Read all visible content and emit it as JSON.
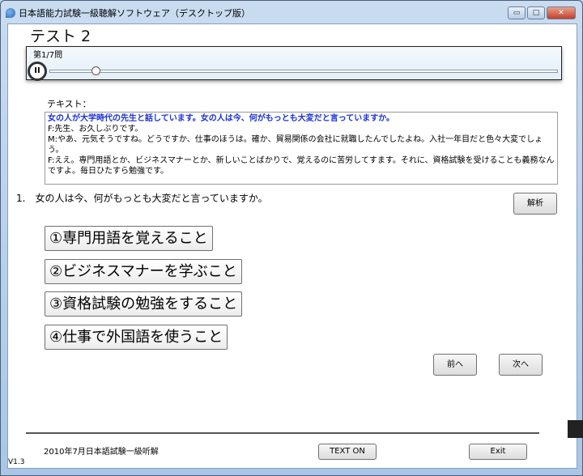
{
  "window": {
    "title": "日本語能力試験一級聴解ソフトウェア（デスクトップ版）",
    "minimize": "▭",
    "maximize": "□",
    "close": "✕"
  },
  "page_title": "テスト 2",
  "player": {
    "question_counter": "第1/7問",
    "pause_label": "II",
    "progress_percent": 9
  },
  "text_label": "テキスト：",
  "transcript": {
    "highlight": "女の人が大学時代の先生と話しています。女の人は今、何がもっとも大変だと言っていますか。",
    "lines": [
      "F:先生、お久しぶりです。",
      "M:やあ、元気そうですね。どうですか、仕事のほうは。確か、貿易関係の会社に就職したんでしたよね。入社一年目だと色々大変でしょう。",
      "F:ええ。専門用語とか、ビジネスマナーとか、新しいことばかりで、覚えるのに苦労してすます。それに、資格試験を受けることも義務なんですよ。毎日ひたすら勉強です。"
    ]
  },
  "question": "1.　女の人は今、何がもっとも大変だと言っていますか。",
  "analysis_button": "解析",
  "choices": [
    "①専門用語を覚えること",
    "②ビジネスマナーを学ぶこと",
    "③資格試験の勉強をすること",
    "④仕事で外国語を使うこと"
  ],
  "prev_button": "前へ",
  "next_button": "次へ",
  "footer": {
    "caption": "2010年7月日本語試験一級听解",
    "text_on_button": "TEXT ON",
    "exit_button": "Exit",
    "version": "V1.3"
  }
}
